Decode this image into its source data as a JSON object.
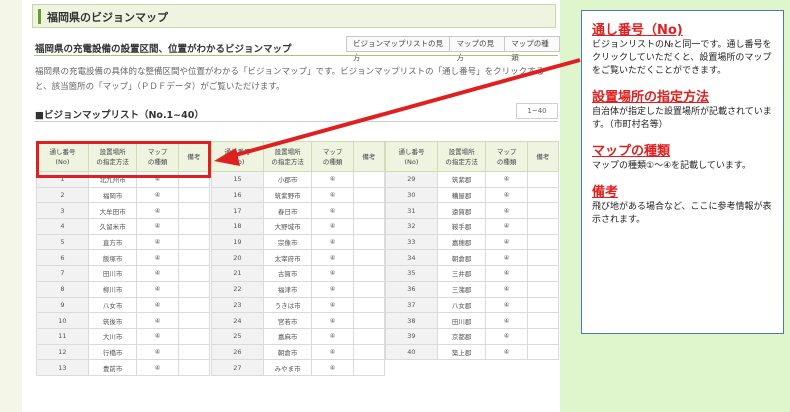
{
  "page": {
    "header_title": "福岡県のビジョンマップ",
    "section_title": "福岡県の充電設備の設置区間、位置がわかるビジョンマップ",
    "tabs": [
      "ビジョンマップリストの見方",
      "マップの見方",
      "マップの種類"
    ],
    "description": "福岡県の充電設備の具体的な整備区間や位置がわかる「ビジョンマップ」です。ビジョンマップリストの「通し番号」をクリックすると、該当箇所の「マップ」（ＰＤＦデータ）がご覧いただけます。",
    "list_title": "■ビジョンマップリスト（No.1~40）",
    "range": "1~40"
  },
  "table": {
    "headers": [
      "通し番号\n(No)",
      "設置場所\nの指定方法",
      "マップ\nの種類",
      "備考"
    ],
    "columns": [
      [
        {
          "no": "1",
          "place": "北九州市",
          "type": "④"
        },
        {
          "no": "2",
          "place": "福岡市",
          "type": "④"
        },
        {
          "no": "3",
          "place": "大牟田市",
          "type": "④"
        },
        {
          "no": "4",
          "place": "久留米市",
          "type": "④"
        },
        {
          "no": "5",
          "place": "直方市",
          "type": "④"
        },
        {
          "no": "6",
          "place": "飯塚市",
          "type": "④"
        },
        {
          "no": "7",
          "place": "田川市",
          "type": "④"
        },
        {
          "no": "8",
          "place": "柳川市",
          "type": "④"
        },
        {
          "no": "9",
          "place": "八女市",
          "type": "④"
        },
        {
          "no": "10",
          "place": "筑後市",
          "type": "④"
        },
        {
          "no": "11",
          "place": "大川市",
          "type": "④"
        },
        {
          "no": "12",
          "place": "行橋市",
          "type": "④"
        },
        {
          "no": "13",
          "place": "豊前市",
          "type": "④"
        }
      ],
      [
        {
          "no": "15",
          "place": "小郡市",
          "type": "④"
        },
        {
          "no": "16",
          "place": "筑紫野市",
          "type": "④"
        },
        {
          "no": "17",
          "place": "春日市",
          "type": "④"
        },
        {
          "no": "18",
          "place": "大野城市",
          "type": "④"
        },
        {
          "no": "19",
          "place": "宗像市",
          "type": "④"
        },
        {
          "no": "20",
          "place": "太宰府市",
          "type": "④"
        },
        {
          "no": "21",
          "place": "古賀市",
          "type": "④"
        },
        {
          "no": "22",
          "place": "福津市",
          "type": "④"
        },
        {
          "no": "23",
          "place": "うきは市",
          "type": "④"
        },
        {
          "no": "24",
          "place": "宮若市",
          "type": "④"
        },
        {
          "no": "25",
          "place": "嘉麻市",
          "type": "④"
        },
        {
          "no": "26",
          "place": "朝倉市",
          "type": "④"
        },
        {
          "no": "27",
          "place": "みやま市",
          "type": "④"
        }
      ],
      [
        {
          "no": "29",
          "place": "筑紫郡",
          "type": "④"
        },
        {
          "no": "30",
          "place": "糟屋郡",
          "type": "④"
        },
        {
          "no": "31",
          "place": "遠賀郡",
          "type": "④"
        },
        {
          "no": "32",
          "place": "鞍手郡",
          "type": "④"
        },
        {
          "no": "33",
          "place": "嘉穂郡",
          "type": "④"
        },
        {
          "no": "34",
          "place": "朝倉郡",
          "type": "④"
        },
        {
          "no": "35",
          "place": "三井郡",
          "type": "④"
        },
        {
          "no": "36",
          "place": "三潴郡",
          "type": "④"
        },
        {
          "no": "37",
          "place": "八女郡",
          "type": "④"
        },
        {
          "no": "38",
          "place": "田川郡",
          "type": "④"
        },
        {
          "no": "39",
          "place": "京都郡",
          "type": "④"
        },
        {
          "no": "40",
          "place": "築上郡",
          "type": "④"
        }
      ]
    ]
  },
  "callout": [
    {
      "title": "通し番号（No)",
      "text": "ビジョンリストの№と同一です。通し番号をクリックしていただくと、設置場所のマップをご覧いただくことができます。"
    },
    {
      "title": "設置場所の指定方法",
      "text": "自治体が指定した設置場所が記載されています。（市町村名等）"
    },
    {
      "title": "マップの種類",
      "text": "マップの種類①～④を記載しています。"
    },
    {
      "title": "備考",
      "text": "飛び地がある場合など、ここに参考情報が表示されます。"
    }
  ],
  "colors": {
    "highlight": "#e02020",
    "accent": "#6a9b2c",
    "callout_border": "#4a78b8"
  }
}
